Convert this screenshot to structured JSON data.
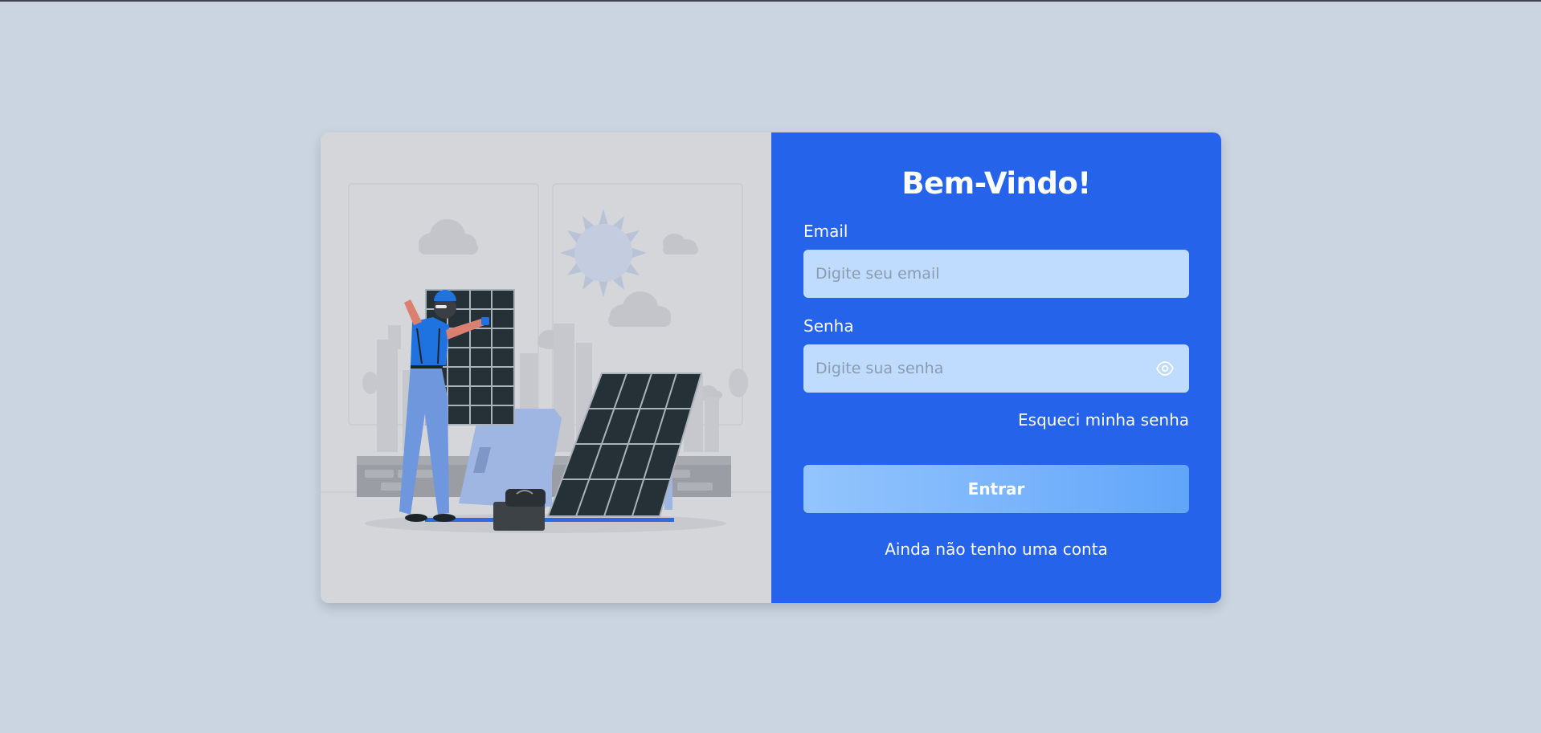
{
  "login": {
    "title": "Bem-Vindo!",
    "email": {
      "label": "Email",
      "placeholder": "Digite seu email",
      "value": ""
    },
    "password": {
      "label": "Senha",
      "placeholder": "Digite sua senha",
      "value": "",
      "toggle_icon": "eye-icon"
    },
    "forgot_password_label": "Esqueci minha senha",
    "submit_label": "Entrar",
    "signup_label": "Ainda não tenho uma conta"
  },
  "illustration": {
    "subject": "worker installing solar panels"
  },
  "colors": {
    "page_background": "#cbd5e1",
    "form_panel": "#2563eb",
    "illustration_panel": "#d4d6da",
    "input_background": "#bfdbfe",
    "button_gradient_start": "#93c5fd",
    "button_gradient_end": "#60a5fa",
    "text": "#ffffff"
  }
}
